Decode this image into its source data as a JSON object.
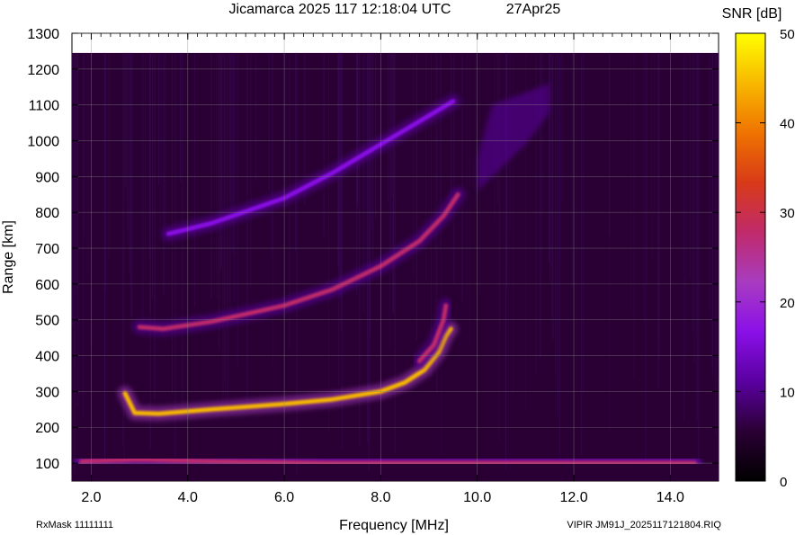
{
  "header": {
    "title": "Jicamarca 2025 117 12:18:04 UTC",
    "date": "27Apr25"
  },
  "footer": {
    "left": "RxMask 11111111",
    "right": "VIPIR  JM91J_2025117121804.RIQ"
  },
  "colorbar": {
    "label": "SNR [dB]",
    "min": 0,
    "max": 50,
    "ticks": [
      "0",
      "10",
      "20",
      "30",
      "40",
      "50"
    ],
    "colors": [
      "#000000",
      "#2a0034",
      "#5a00a0",
      "#8a10e8",
      "#a83cc0",
      "#c02a6a",
      "#d83a18",
      "#ef7300",
      "#f8b800",
      "#ffff00"
    ]
  },
  "chart_data": {
    "type": "heatmap",
    "title": "Jicamarca 2025 117 12:18:04 UTC",
    "xlabel": "Frequency [MHz]",
    "ylabel": "Range [km]",
    "xlim": [
      1.6,
      15.0
    ],
    "ylim": [
      50,
      1300
    ],
    "xticks": [
      "2.0",
      "4.0",
      "6.0",
      "8.0",
      "10.0",
      "12.0",
      "14.0"
    ],
    "yticks": [
      "100",
      "200",
      "300",
      "400",
      "500",
      "600",
      "700",
      "800",
      "900",
      "1000",
      "1100",
      "1200",
      "1300"
    ],
    "grid": true,
    "background_snr_db": 3,
    "traces": [
      {
        "name": "E-layer echo",
        "snr_db": 30,
        "points": [
          [
            1.8,
            105
          ],
          [
            3.0,
            110
          ],
          [
            4.5,
            105
          ],
          [
            7.0,
            100
          ],
          [
            10.0,
            100
          ],
          [
            12.0,
            100
          ],
          [
            14.5,
            100
          ]
        ]
      },
      {
        "name": "F-layer O-trace",
        "snr_db": 45,
        "points": [
          [
            2.7,
            295
          ],
          [
            2.9,
            240
          ],
          [
            3.4,
            238
          ],
          [
            4.5,
            250
          ],
          [
            6.0,
            265
          ],
          [
            7.0,
            278
          ],
          [
            8.0,
            300
          ],
          [
            8.5,
            325
          ],
          [
            8.9,
            360
          ],
          [
            9.2,
            410
          ],
          [
            9.35,
            455
          ],
          [
            9.45,
            475
          ]
        ]
      },
      {
        "name": "F-layer X-trace",
        "snr_db": 25,
        "points": [
          [
            8.8,
            385
          ],
          [
            9.1,
            430
          ],
          [
            9.3,
            500
          ],
          [
            9.35,
            540
          ]
        ]
      },
      {
        "name": "F-layer second hop",
        "snr_db": 25,
        "points": [
          [
            3.0,
            480
          ],
          [
            3.5,
            475
          ],
          [
            4.5,
            495
          ],
          [
            6.0,
            540
          ],
          [
            7.0,
            585
          ],
          [
            8.0,
            650
          ],
          [
            8.8,
            720
          ],
          [
            9.3,
            790
          ],
          [
            9.6,
            850
          ]
        ]
      },
      {
        "name": "F-layer third hop",
        "snr_db": 17,
        "points": [
          [
            3.6,
            740
          ],
          [
            4.5,
            770
          ],
          [
            6.0,
            840
          ],
          [
            7.0,
            910
          ],
          [
            8.0,
            990
          ],
          [
            9.0,
            1070
          ],
          [
            9.5,
            1110
          ]
        ]
      },
      {
        "name": "Spread F patch",
        "snr_db": 12,
        "points": [
          [
            10.0,
            860
          ],
          [
            11.0,
            990
          ],
          [
            11.5,
            1080
          ],
          [
            11.5,
            1160
          ],
          [
            10.3,
            1100
          ],
          [
            10.0,
            950
          ]
        ]
      }
    ]
  }
}
